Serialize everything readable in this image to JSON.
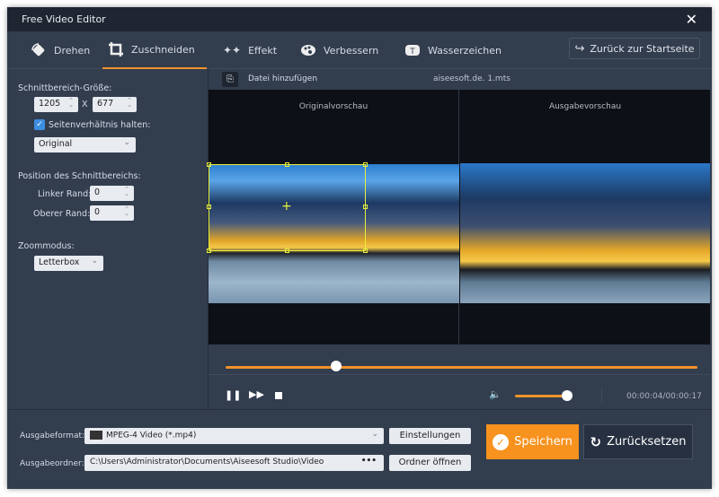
{
  "window": {
    "title": "Free Video Editor"
  },
  "tabs": [
    {
      "label": "Drehen",
      "icon": "rotate-icon"
    },
    {
      "label": "Zuschneiden",
      "icon": "crop-icon",
      "active": true
    },
    {
      "label": "Effekt",
      "icon": "stars-icon"
    },
    {
      "label": "Verbessern",
      "icon": "palette-icon"
    },
    {
      "label": "Wasserzeichen",
      "icon": "watermark-icon"
    }
  ],
  "home_button": "Zurück zur Startseite",
  "crop": {
    "size_label": "Schnittbereich-Größe:",
    "width": "1205",
    "x": "X",
    "height": "677",
    "keep_ratio_label": "Seitenverhältnis halten:",
    "keep_ratio": true,
    "ratio": "Original",
    "position_label": "Position des Schnittbereichs:",
    "left_label": "Linker Rand:",
    "left": "0",
    "top_label": "Oberer Rand:",
    "top": "0",
    "zoom_label": "Zoommodus:",
    "zoom_mode": "Letterbox"
  },
  "file": {
    "add_label": "Datei hinzufügen",
    "name": "aiseesoft.de. 1.mts"
  },
  "preview": {
    "original": "Originalvorschau",
    "output": "Ausgabevorschau"
  },
  "player": {
    "progress": 0.235,
    "volume": 1.0,
    "time": "00:00:04/00:00:17"
  },
  "output": {
    "format_label": "Ausgabeformat:",
    "format": "MPEG-4 Video (*.mp4)",
    "settings": "Einstellungen",
    "folder_label": "Ausgabeordner:",
    "folder": "C:\\Users\\Administrator\\Documents\\Aiseesoft Studio\\Video",
    "browse": "•••",
    "open_folder": "Ordner öffnen"
  },
  "actions": {
    "save": "Speichern",
    "reset": "Zurücksetzen"
  },
  "colors": {
    "accent": "#f7921e",
    "bg": "#323d4e",
    "title": "#1f2632"
  }
}
